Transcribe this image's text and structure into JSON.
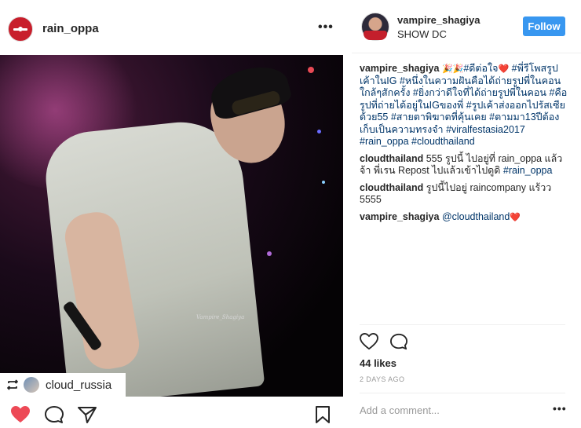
{
  "post_author": {
    "username": "rain_oppa",
    "more_label": "•••"
  },
  "photo": {
    "watermark": "Vampire_Shagiya"
  },
  "repost": {
    "username": "cloud_russia"
  },
  "right_header": {
    "username": "vampire_shagiya",
    "location": "SHOW DC",
    "follow_label": "Follow"
  },
  "caption": {
    "username": "vampire_shagiya",
    "segments": [
      {
        "text": " 🎉🎉",
        "kind": "emoji"
      },
      {
        "text": "#ดีต่อใจ",
        "kind": "tag"
      },
      {
        "text": "❤️ ",
        "kind": "emoji"
      },
      {
        "text": "#พี่รีโพสรูปเค้าในIG",
        "kind": "tag"
      },
      {
        "text": " ",
        "kind": "text"
      },
      {
        "text": "#หนึ่งในความฝันคือได้ถ่ายรูปพี่ในคอนใกล้ๆสักครั้ง",
        "kind": "tag"
      },
      {
        "text": " ",
        "kind": "text"
      },
      {
        "text": "#ยิ่งกว่าดีใจที่ได้ถ่ายรูปพี่ในคอน",
        "kind": "tag"
      },
      {
        "text": " ",
        "kind": "text"
      },
      {
        "text": "#คือรูปที่ถ่ายได้อยู่ในIGของพี่",
        "kind": "tag"
      },
      {
        "text": " ",
        "kind": "text"
      },
      {
        "text": "#รูปเค้าส่งออกไปรัสเซียด้วย55",
        "kind": "tag"
      },
      {
        "text": " ",
        "kind": "text"
      },
      {
        "text": "#สายตาพิฆาตที่คุ้นเคย",
        "kind": "tag"
      },
      {
        "text": " ",
        "kind": "text"
      },
      {
        "text": "#ตามมา13ปีต้องเก็บเป็นความทรงจำ",
        "kind": "tag"
      },
      {
        "text": " ",
        "kind": "text"
      },
      {
        "text": "#viralfestasia2017",
        "kind": "tag"
      },
      {
        "text": " ",
        "kind": "text"
      },
      {
        "text": "#rain_oppa",
        "kind": "tag"
      },
      {
        "text": " ",
        "kind": "text"
      },
      {
        "text": "#cloudthailand",
        "kind": "tag"
      }
    ]
  },
  "comments": [
    {
      "username": "cloudthailand",
      "text": " 555 รูปนี้ ไปอยู่ที่ rain_oppa แล้วจ้า พี่เรน Repost ไปแล้วเข้าไปดูดิ ",
      "tag": "#rain_oppa",
      "emoji": ""
    },
    {
      "username": "cloudthailand",
      "text": " รูปนี้ไปอยู่ raincompany แร้วว 5555",
      "tag": "",
      "emoji": ""
    },
    {
      "username": "vampire_shagiya",
      "text": " ",
      "tag": "@cloudthailand",
      "emoji": "❤️"
    }
  ],
  "likes": "44 likes",
  "timestamp": "2 DAYS AGO",
  "add_comment": {
    "placeholder": "Add a comment..."
  },
  "comment_more_label": "•••",
  "icons": {
    "like": "heart-icon",
    "comment": "comment-icon",
    "share": "share-icon",
    "save": "bookmark-icon",
    "repost": "repost-icon"
  },
  "colors": {
    "link": "#003569",
    "follow": "#3897f0",
    "liked": "#ed4956"
  }
}
